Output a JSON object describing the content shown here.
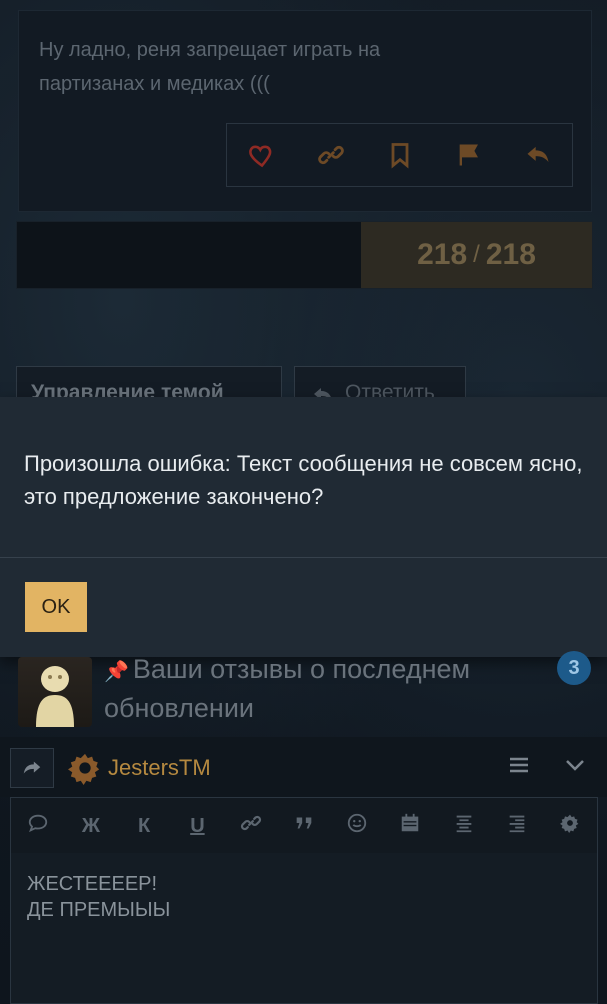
{
  "post": {
    "text_line1": "Ну ладно, реня запрещает играть на",
    "text_line2": "партизанах и медиках (((",
    "actions": [
      "heart-icon",
      "link-icon",
      "bookmark-icon",
      "flag-icon",
      "reply-icon"
    ]
  },
  "pager": {
    "current": "218",
    "separator": "/",
    "total": "218"
  },
  "thread_controls": {
    "manage_label": "Управление темой",
    "reply_label": "Ответить"
  },
  "dialog": {
    "message": "Произошла ошибка: Текст сообщения не совсем ясно, это предложение закончено?",
    "ok_label": "OK"
  },
  "thread_item": {
    "title": "Ваши отзывы о последнем обновлении",
    "badge": "3"
  },
  "editor": {
    "username": "JestersTM",
    "toolbar": [
      "comment-icon",
      "Ж",
      "К",
      "U",
      "link-icon",
      "quote-icon",
      "smile-icon",
      "calendar-icon",
      "align-center-icon",
      "align-right-icon",
      "gear-icon"
    ],
    "text_line1": "ЖЕСТЕЕЕЕР!",
    "text_line2": "ДЕ ПРЕМЫЫЫ"
  },
  "colors": {
    "accent": "#e2b463",
    "dialog_bg": "#202a34",
    "badge": "#1d5a8a",
    "heart": "#c0392b",
    "icon_brown": "#8a5a2b"
  }
}
